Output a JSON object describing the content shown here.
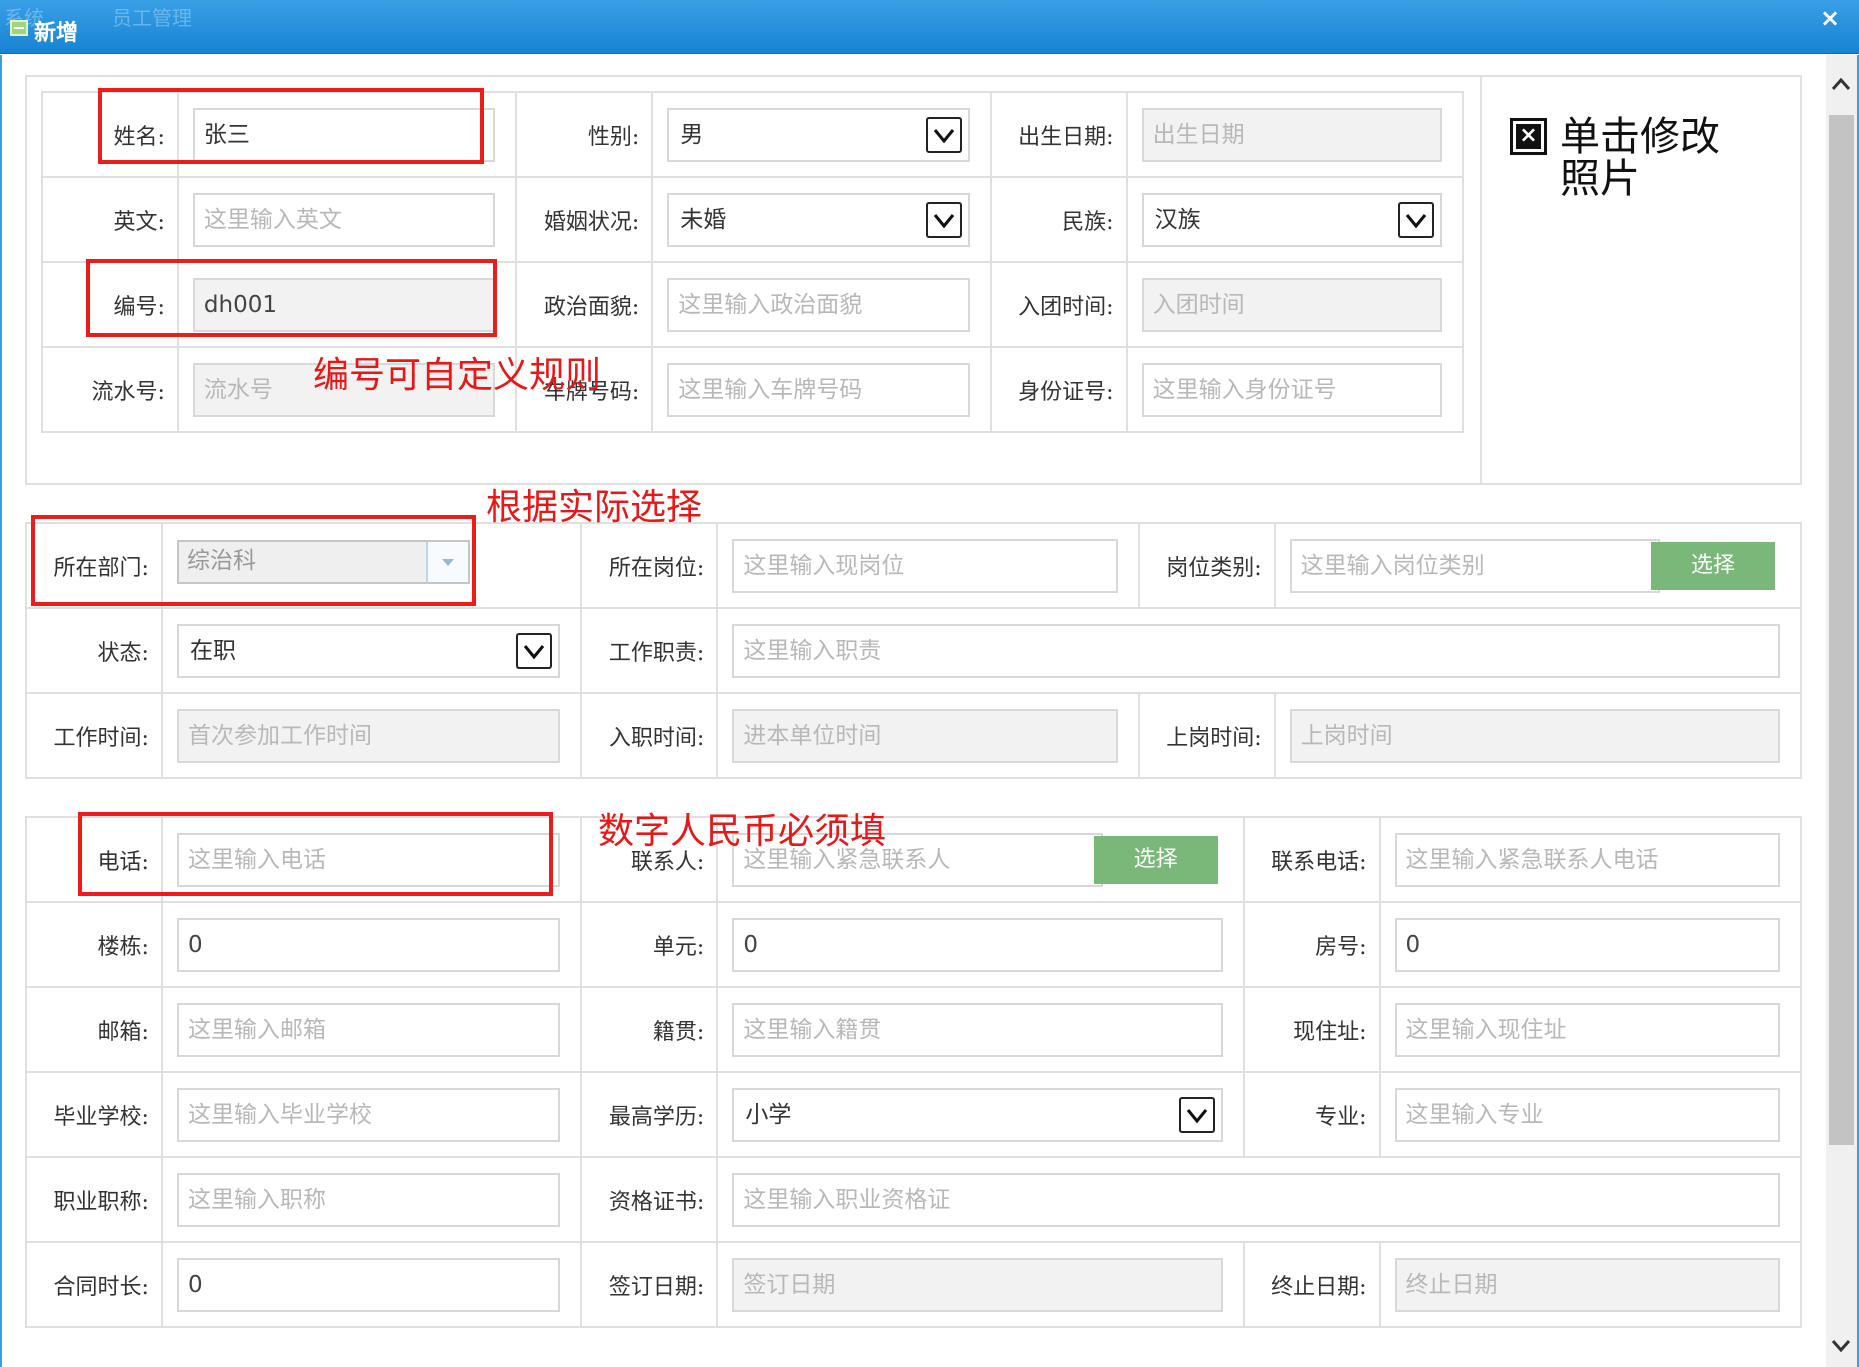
{
  "window": {
    "title": "新增",
    "background_tabs": [
      "系统",
      "员工管理"
    ],
    "close_label": "×"
  },
  "section1": {
    "rows": [
      [
        {
          "label": "姓名:",
          "type": "input",
          "value": "张三"
        },
        {
          "label": "性别:",
          "type": "select",
          "value": "男"
        },
        {
          "label": "出生日期:",
          "type": "readonly",
          "placeholder": "出生日期"
        }
      ],
      [
        {
          "label": "英文:",
          "type": "input",
          "placeholder": "这里输入英文"
        },
        {
          "label": "婚姻状况:",
          "type": "select",
          "value": "未婚"
        },
        {
          "label": "民族:",
          "type": "select",
          "value": "汉族"
        }
      ],
      [
        {
          "label": "编号:",
          "type": "readonly",
          "value": "dh001"
        },
        {
          "label": "政治面貌:",
          "type": "input",
          "placeholder": "这里输入政治面貌"
        },
        {
          "label": "入团时间:",
          "type": "readonly",
          "placeholder": "入团时间"
        }
      ],
      [
        {
          "label": "流水号:",
          "type": "readonly",
          "placeholder": "流水号"
        },
        {
          "label": "车牌号码:",
          "type": "input",
          "placeholder": "这里输入车牌号码"
        },
        {
          "label": "身份证号:",
          "type": "input",
          "placeholder": "这里输入身份证号"
        }
      ]
    ],
    "photo_text": "单击修改照片"
  },
  "section2": {
    "department_label": "所在部门:",
    "department_value": "综治科",
    "post_label": "所在岗位:",
    "post_placeholder": "这里输入现岗位",
    "post_type_label": "岗位类别:",
    "post_type_placeholder": "这里输入岗位类别",
    "select_button": "选择",
    "status_label": "状态:",
    "status_value": "在职",
    "duty_label": "工作职责:",
    "duty_placeholder": "这里输入职责",
    "work_time_label": "工作时间:",
    "work_time_placeholder": "首次参加工作时间",
    "entry_time_label": "入职时间:",
    "entry_time_placeholder": "进本单位时间",
    "onpost_time_label": "上岗时间:",
    "onpost_time_placeholder": "上岗时间"
  },
  "section3": {
    "phone_label": "电话:",
    "phone_placeholder": "这里输入电话",
    "contact_label": "联系人:",
    "contact_placeholder": "这里输入紧急联系人",
    "contact_select_button": "选择",
    "contact_phone_label": "联系电话:",
    "contact_phone_placeholder": "这里输入紧急联系人电话",
    "building_label": "楼栋:",
    "building_value": "0",
    "unit_label": "单元:",
    "unit_value": "0",
    "room_label": "房号:",
    "room_value": "0",
    "email_label": "邮箱:",
    "email_placeholder": "这里输入邮箱",
    "native_label": "籍贯:",
    "native_placeholder": "这里输入籍贯",
    "address_label": "现住址:",
    "address_placeholder": "这里输入现住址",
    "school_label": "毕业学校:",
    "school_placeholder": "这里输入毕业学校",
    "edu_label": "最高学历:",
    "edu_value": "小学",
    "major_label": "专业:",
    "major_placeholder": "这里输入专业",
    "title_label": "职业职称:",
    "title_placeholder": "这里输入职称",
    "cert_label": "资格证书:",
    "cert_placeholder": "这里输入职业资格证",
    "contract_label": "合同时长:",
    "contract_value": "0",
    "sign_label": "签订日期:",
    "sign_placeholder": "签订日期",
    "end_label": "终止日期:",
    "end_placeholder": "终止日期"
  },
  "annotations": {
    "id_rule": "编号可自定义规则",
    "dept_note": "根据实际选择",
    "phone_note": "数字人民币必须填"
  },
  "colors": {
    "titlebar": "#1683d3",
    "annotation_red": "#ee1b1b",
    "button_green": "#7ab87a"
  }
}
